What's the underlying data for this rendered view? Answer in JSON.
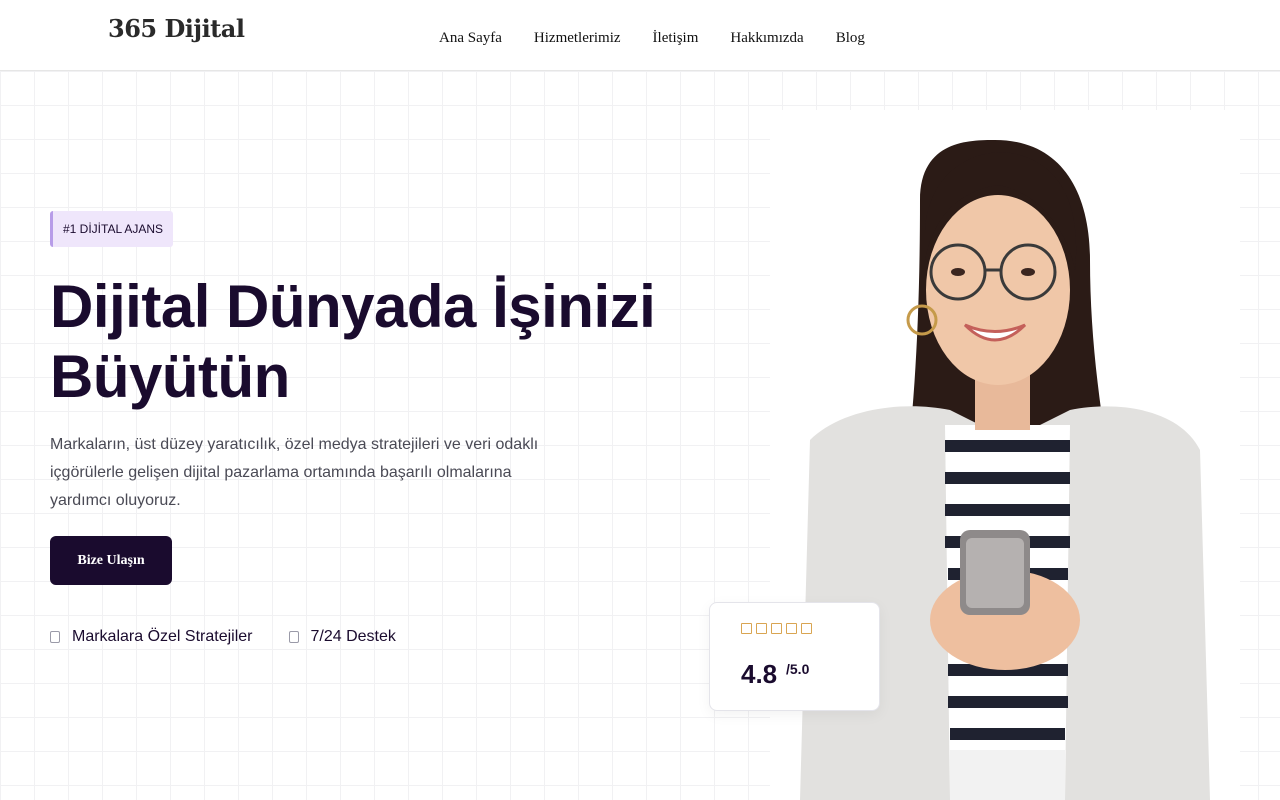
{
  "header": {
    "logo": "365 Dijital",
    "nav": [
      "Ana Sayfa",
      "Hizmetlerimiz",
      "İletişim",
      "Hakkımızda",
      "Blog"
    ]
  },
  "hero": {
    "badge": "#1 DİJİTAL AJANS",
    "title_line1": "Dijital Dünyada İşinizi",
    "title_line2": "Büyütün",
    "description": "Markaların, üst düzey yaratıcılık, özel medya stratejileri ve veri odaklı içgörülerle gelişen dijital pazarlama ortamında başarılı olmalarına yardımcı oluyoruz.",
    "cta_label": "Bize Ulaşın",
    "features": [
      "Markalara Özel Stratejiler",
      "7/24 Destek"
    ]
  },
  "rating": {
    "score": "4.8",
    "max": "/5.0",
    "stars": 5
  },
  "colors": {
    "primary": "#1a0b2e",
    "badge_bg": "#efe6fb",
    "star": "#d9a552"
  }
}
